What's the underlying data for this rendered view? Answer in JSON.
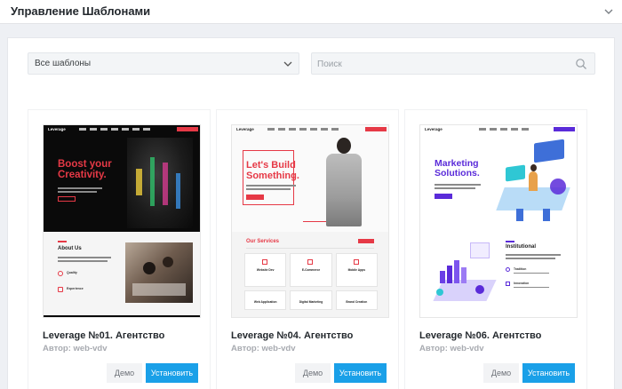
{
  "header": {
    "title": "Управление Шаблонами"
  },
  "filters": {
    "category_selected": "Все шаблоны",
    "search_placeholder": "Поиск"
  },
  "templates": [
    {
      "title": "Leverage №01. Агентство",
      "author": "Автор: web-vdv",
      "demo_label": "Демо",
      "install_label": "Установить",
      "preview": {
        "logo": "Leverage",
        "hero_line1": "Boost your",
        "hero_line2": "Creativity.",
        "section_title": "About Us",
        "feature1": "Quality",
        "feature2": "Experience"
      }
    },
    {
      "title": "Leverage №04. Агентство",
      "author": "Автор: web-vdv",
      "demo_label": "Демо",
      "install_label": "Установить",
      "preview": {
        "logo": "Leverage",
        "hero_line1": "Let's Build",
        "hero_line2": "Something.",
        "section_title": "Our Services",
        "services": [
          "Website Dev",
          "E-Commerce",
          "Mobile Apps",
          "Web Application",
          "Digital Marketing",
          "Brand Creation"
        ]
      }
    },
    {
      "title": "Leverage №06. Агентство",
      "author": "Автор: web-vdv",
      "demo_label": "Демо",
      "install_label": "Установить",
      "preview": {
        "logo": "Leverage",
        "hero_line1": "Marketing",
        "hero_line2": "Solutions.",
        "section_title": "Institutional",
        "feature1": "Tradition",
        "feature2": "Innovation"
      }
    }
  ],
  "colors": {
    "accent": "#1aa0e8",
    "leverage01_red": "#e63946",
    "leverage06_purple": "#5a2bd9"
  }
}
